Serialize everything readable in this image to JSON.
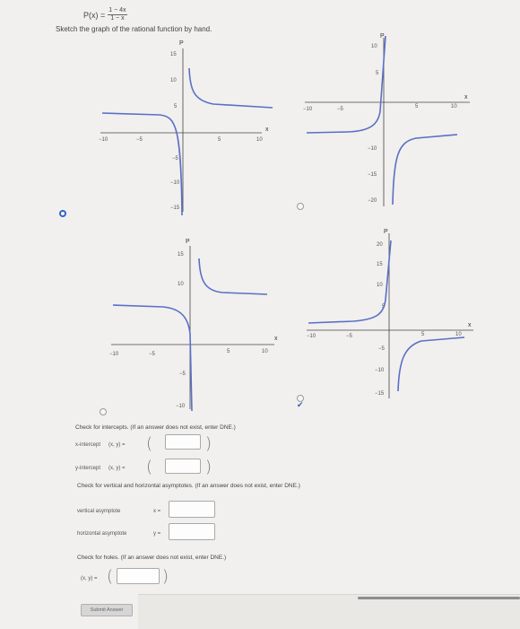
{
  "formula": {
    "lhs": "P(x) =",
    "numerator": "1 − 4x",
    "denominator": "1 − x"
  },
  "prompt": "Sketch the graph of the rational function by hand.",
  "graph_options": [
    {
      "selected": true,
      "axis_x_label": "x",
      "axis_y_label": "P",
      "x_ticks": [
        "−10",
        "−5",
        "5",
        "10"
      ],
      "y_ticks": [
        "15",
        "10",
        "5",
        "−5",
        "−10",
        "−15"
      ]
    },
    {
      "selected": false,
      "axis_x_label": "x",
      "axis_y_label": "P",
      "x_ticks": [
        "−10",
        "−5",
        "5",
        "10"
      ],
      "y_ticks": [
        "10",
        "5",
        "−10",
        "−15",
        "−20"
      ]
    },
    {
      "selected": false,
      "axis_x_label": "x",
      "axis_y_label": "P",
      "x_ticks": [
        "−10",
        "−5",
        "5",
        "10"
      ],
      "y_ticks": [
        "15",
        "10",
        "−5",
        "−10"
      ]
    },
    {
      "selected": false,
      "axis_x_label": "x",
      "axis_y_label": "P",
      "x_ticks": [
        "−10",
        "−5",
        "5",
        "10"
      ],
      "y_ticks": [
        "20",
        "15",
        "10",
        "5",
        "−5",
        "−10",
        "−15"
      ]
    }
  ],
  "intercepts": {
    "heading": "Check for intercepts. (If an answer does not exist, enter DNE.)",
    "x_label": "x-intercept",
    "y_label": "y-intercept",
    "pair_label": "(x, y) =",
    "x_value": "",
    "y_value": ""
  },
  "asymptotes": {
    "heading": "Check for vertical and horizontal asymptotes. (If an answer does not exist, enter DNE.)",
    "vertical_label": "vertical asymptote",
    "vertical_prefix": "x =",
    "horizontal_label": "horizontal asymptote",
    "horizontal_prefix": "y =",
    "vertical_value": "",
    "horizontal_value": ""
  },
  "holes": {
    "heading": "Check for holes. (If an answer does not exist, enter DNE.)",
    "pair_label": "(x, y) =",
    "value": ""
  },
  "submit_label": "Submit Answer",
  "colors": {
    "curve": "#5a6fc7",
    "axis": "#444444",
    "selected_radio": "#2f64c8",
    "check": "#3b5cb5"
  }
}
